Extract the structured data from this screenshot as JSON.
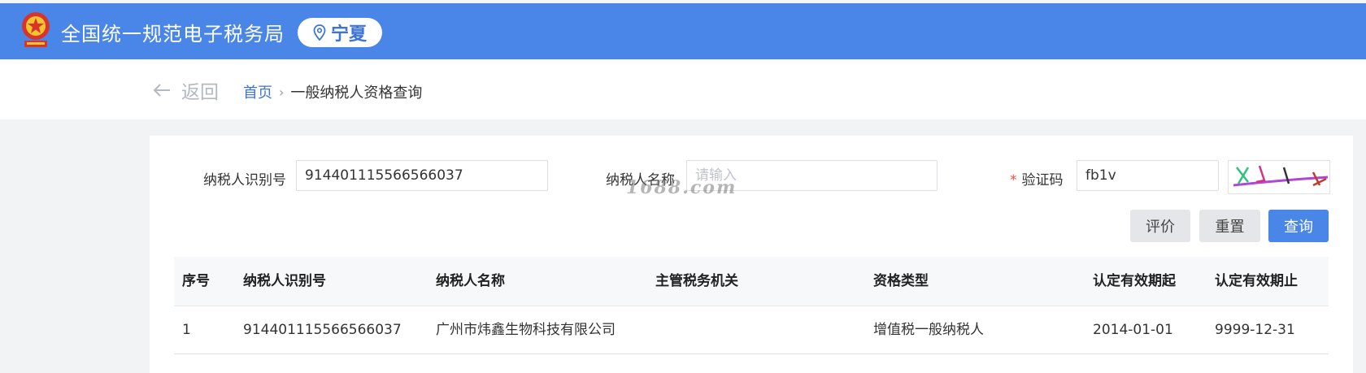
{
  "header": {
    "site_title": "全国统一规范电子税务局",
    "region": "宁夏",
    "brand_color": "#4a86e8"
  },
  "breadcrumb": {
    "back_label": "返回",
    "home": "首页",
    "current": "一般纳税人资格查询"
  },
  "form": {
    "taxpayer_id_label": "纳税人识别号",
    "taxpayer_id_value": "914401115566566037",
    "taxpayer_name_label": "纳税人名称",
    "taxpayer_name_placeholder": "请输入",
    "captcha_required_mark": "*",
    "captcha_label": "验证码",
    "captcha_value": "fb1v"
  },
  "buttons": {
    "evaluate": "评价",
    "reset": "重置",
    "search": "查询"
  },
  "watermark": "1688.com",
  "table": {
    "columns": [
      "序号",
      "纳税人识别号",
      "纳税人名称",
      "主管税务机关",
      "资格类型",
      "认定有效期起",
      "认定有效期止"
    ],
    "rows": [
      [
        "1",
        "914401115566566037",
        "广州市炜鑫生物科技有限公司",
        "",
        "增值税一般纳税人",
        "2014-01-01",
        "9999-12-31"
      ]
    ]
  }
}
